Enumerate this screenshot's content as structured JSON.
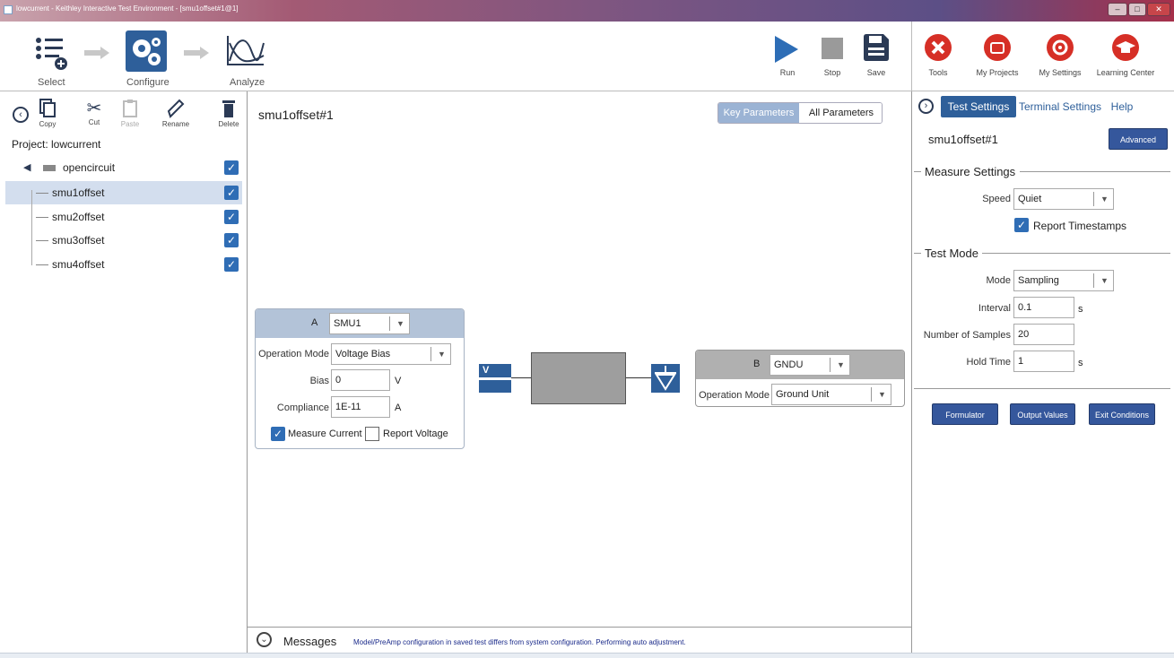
{
  "window": {
    "title": "lowcurrent - Keithley Interactive Test Environment - [smu1offset#1@1]"
  },
  "workflow": {
    "select_label": "Select",
    "configure_label": "Configure",
    "analyze_label": "Analyze"
  },
  "run_controls": {
    "run_label": "Run",
    "stop_label": "Stop",
    "save_label": "Save"
  },
  "apps": {
    "tools_label": "Tools",
    "projects_label": "My Projects",
    "settings_label": "My Settings",
    "learning_label": "Learning Center"
  },
  "project_tools": {
    "copy": "Copy",
    "cut": "Cut",
    "paste": "Paste",
    "rename": "Rename",
    "delete": "Delete"
  },
  "project": {
    "label": "Project: lowcurrent",
    "group": "opencircuit",
    "items": [
      {
        "label": "smu1offset",
        "selected": true
      },
      {
        "label": "smu2offset"
      },
      {
        "label": "smu3offset"
      },
      {
        "label": "smu4offset"
      }
    ]
  },
  "test": {
    "title": "smu1offset#1"
  },
  "param_toggle": {
    "key": "Key Parameters",
    "all": "All Parameters"
  },
  "terminal_a": {
    "terminal": "A",
    "instrument": "SMU1",
    "operation_mode_label": "Operation Mode",
    "operation_mode": "Voltage Bias",
    "bias_label": "Bias",
    "bias": "0",
    "bias_unit": "V",
    "compliance_label": "Compliance",
    "compliance": "1E-11",
    "compliance_unit": "A",
    "measure_current_label": "Measure Current",
    "report_voltage_label": "Report Voltage"
  },
  "source_icon_label": "V",
  "terminal_b": {
    "terminal": "B",
    "instrument": "GNDU",
    "operation_mode_label": "Operation Mode",
    "operation_mode": "Ground Unit"
  },
  "messages": {
    "label": "Messages",
    "text": "Model/PreAmp configuration in saved test differs from system configuration. Performing auto adjustment."
  },
  "right_tabs": {
    "test_settings": "Test Settings",
    "terminal_settings": "Terminal Settings",
    "help": "Help"
  },
  "right": {
    "test_name": "smu1offset#1",
    "advanced": "Advanced",
    "measure_settings": "Measure Settings",
    "speed_label": "Speed",
    "speed": "Quiet",
    "report_timestamps": "Report Timestamps",
    "test_mode": "Test Mode",
    "mode_label": "Mode",
    "mode": "Sampling",
    "interval_label": "Interval",
    "interval": "0.1",
    "interval_unit": "s",
    "samples_label": "Number of Samples",
    "samples": "20",
    "hold_label": "Hold Time",
    "hold": "1",
    "hold_unit": "s",
    "formulator": "Formulator",
    "output_values": "Output Values",
    "exit_conditions": "Exit Conditions"
  },
  "colors": {
    "accent": "#2f6db5",
    "app_red": "#d62f26",
    "button_blue": "#35579c",
    "selected_row": "#d3deee",
    "card_header_a": "#b3c3d8",
    "card_header_b": "#b0b0b0"
  }
}
